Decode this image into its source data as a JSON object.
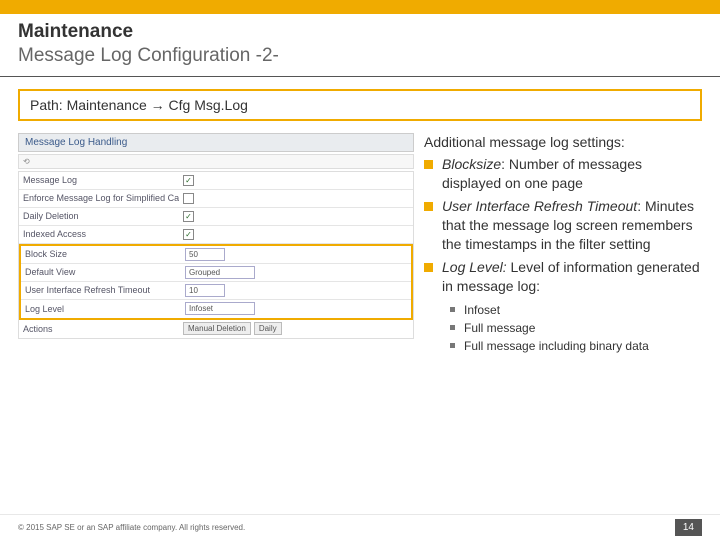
{
  "header": {
    "title_strong": "Maintenance",
    "title_sub": "Message Log Configuration -2-"
  },
  "path": {
    "label": "Path: Maintenance → Cfg Msg.Log"
  },
  "panel": {
    "title": "Message Log Handling",
    "toolbar": "⟲",
    "rows": [
      {
        "label": "Message Log",
        "value": "checked"
      },
      {
        "label": "Enforce Message Log for Simplified Calls",
        "value": "unchecked"
      },
      {
        "label": "Daily Deletion",
        "value": "checked"
      },
      {
        "label": "Indexed Access",
        "value": "checked"
      }
    ],
    "hrows": [
      {
        "label": "Block Size",
        "value": "50"
      },
      {
        "label": "Default View",
        "value": "Grouped"
      },
      {
        "label": "User Interface Refresh Timeout",
        "value": "10"
      },
      {
        "label": "Log Level",
        "value": "Infoset"
      }
    ],
    "actions": {
      "label": "Actions",
      "b1": "Manual Deletion",
      "b2": "Daily"
    }
  },
  "side": {
    "heading": "Additional message log settings:",
    "items": [
      {
        "term": "Blocksize",
        "desc": ": Number of messages displayed on one page"
      },
      {
        "term": "User Interface Refresh Timeout",
        "desc": ": Minutes that the message log screen remembers the timestamps in the filter setting"
      },
      {
        "term": "Log Level:",
        "desc": " Level of information generated in message log:"
      }
    ],
    "subitems": [
      "Infoset",
      "Full message",
      "Full message including binary data"
    ]
  },
  "footer": {
    "copyright": "© 2015 SAP SE or an SAP affiliate company. All rights reserved.",
    "page": "14"
  }
}
